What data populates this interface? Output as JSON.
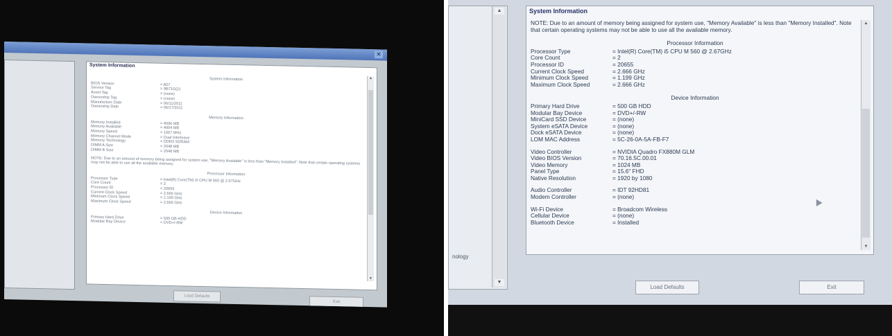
{
  "left": {
    "heading": "System Information",
    "sections": {
      "system": {
        "title": "System Information",
        "rows": [
          {
            "k": "BIOS Version",
            "v": "= A07"
          },
          {
            "k": "Service Tag",
            "v": "= 9B71GQ1"
          },
          {
            "k": "Asset Tag",
            "v": "= (none)"
          },
          {
            "k": "Ownership Tag",
            "v": "= (none)"
          },
          {
            "k": "Manufacture Date",
            "v": "= 06/11/2011"
          },
          {
            "k": "Ownership Date",
            "v": "= 06/17/2011"
          }
        ]
      },
      "memory": {
        "title": "Memory Information",
        "rows": [
          {
            "k": "Memory Installed",
            "v": "= 4096 MB"
          },
          {
            "k": "Memory Available",
            "v": "= 4004 MB"
          },
          {
            "k": "Memory Speed",
            "v": "= 1067 MHz"
          },
          {
            "k": "Memory Channel Mode",
            "v": "= Dual Interleave"
          },
          {
            "k": "Memory Technology",
            "v": "= DDR3 SDRAM"
          },
          {
            "k": "DIMM A Size",
            "v": "= 2048 MB"
          },
          {
            "k": "DIMM B Size",
            "v": "= 2048 MB"
          }
        ]
      },
      "note": "NOTE: Due to an amount of memory being assigned for system use, \"Memory Available\" is less than \"Memory Installed\". Note that certain operating systems may not be able to use all the available memory.",
      "processor": {
        "title": "Processor Information",
        "rows": [
          {
            "k": "Processor Type",
            "v": "= Intel(R) Core(TM) i5 CPU      M 560  @ 2.67GHz"
          },
          {
            "k": "Core Count",
            "v": "= 2"
          },
          {
            "k": "Processor ID",
            "v": "= 20655"
          },
          {
            "k": "Current Clock Speed",
            "v": "= 2.666 GHz"
          },
          {
            "k": "Minimum Clock Speed",
            "v": "= 1.199 GHz"
          },
          {
            "k": "Maximum Clock Speed",
            "v": "= 2.666 GHz"
          }
        ]
      },
      "device": {
        "title": "Device Information",
        "rows": [
          {
            "k": "Primary Hard Drive",
            "v": "= 500 GB HDD"
          },
          {
            "k": "Modular Bay Device",
            "v": "= DVD+/-RW"
          }
        ]
      }
    },
    "buttons": {
      "load_defaults": "Load Defaults",
      "exit": "Exit"
    }
  },
  "right": {
    "heading": "System Information",
    "note": "NOTE: Due to an amount of memory being assigned for system use, \"Memory Available\" is less than \"Memory Installed\". Note that certain operating systems may not be able to use all the available memory.",
    "processor": {
      "title": "Processor Information",
      "rows": [
        {
          "k": "Processor Type",
          "v": "= Intel(R) Core(TM) i5 CPU      M 560  @ 2.67GHz"
        },
        {
          "k": "Core Count",
          "v": "= 2"
        },
        {
          "k": "Processor ID",
          "v": "= 20655"
        },
        {
          "k": "Current Clock Speed",
          "v": "= 2.666 GHz"
        },
        {
          "k": "Minimum Clock Speed",
          "v": "= 1.199 GHz"
        },
        {
          "k": "Maximum Clock Speed",
          "v": "= 2.666 GHz"
        }
      ]
    },
    "device": {
      "title": "Device Information",
      "group1": [
        {
          "k": "Primary Hard Drive",
          "v": "= 500 GB HDD"
        },
        {
          "k": "Modular Bay Device",
          "v": "= DVD+/-RW"
        },
        {
          "k": "MiniCard SSD Device",
          "v": "= (none)"
        },
        {
          "k": "System eSATA Device",
          "v": "= (none)"
        },
        {
          "k": "Dock eSATA Device",
          "v": "= (none)"
        },
        {
          "k": "LOM MAC Address",
          "v": "= 5C-26-0A-5A-FB-F7"
        }
      ],
      "group2": [
        {
          "k": "Video Controller",
          "v": "= NVIDIA Quadro FX880M GLM"
        },
        {
          "k": "Video BIOS Version",
          "v": "= 70.16.5C.00.01"
        },
        {
          "k": "Video Memory",
          "v": "= 1024 MB"
        },
        {
          "k": "Panel Type",
          "v": "= 15.6\" FHD"
        },
        {
          "k": "Native Resolution",
          "v": "= 1920 by 1080"
        }
      ],
      "group3": [
        {
          "k": "Audio Controller",
          "v": "= IDT 92HD81"
        },
        {
          "k": "Modem Controller",
          "v": "= (none)"
        }
      ],
      "group4": [
        {
          "k": "Wi-Fi Device",
          "v": "= Broadcom Wireless"
        },
        {
          "k": "Cellular Device",
          "v": "= (none)"
        },
        {
          "k": "Bluetooth Device",
          "v": "= Installed"
        }
      ]
    },
    "tree_label": "nology",
    "buttons": {
      "load_defaults": "Load Defaults",
      "exit": "Exit"
    }
  }
}
